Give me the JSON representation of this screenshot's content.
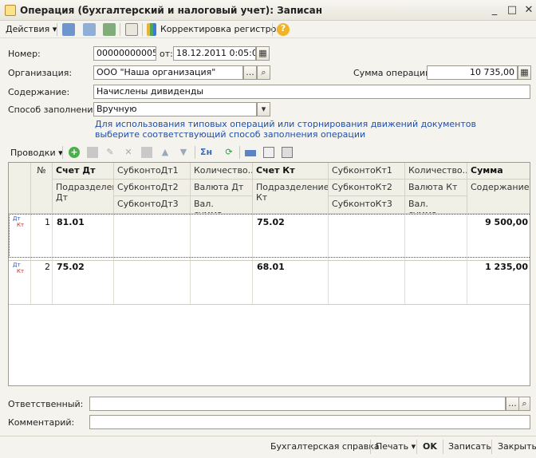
{
  "window": {
    "title": "Операция (бухгалтерский и налоговый учет): Записан"
  },
  "toolbar": {
    "actions": "Действия",
    "registers": "Корректировка регистров",
    "help_icon": "?"
  },
  "form": {
    "number_label": "Номер:",
    "number_value": "00000000005",
    "from_label": "от:",
    "date_value": "18.12.2011  0:05:05",
    "org_label": "Организация:",
    "org_value": "ООО \"Наша организация\"",
    "sum_label": "Сумма операции:",
    "sum_value": "10 735,00",
    "content_label": "Содержание:",
    "content_value": "Начислены дивиденды",
    "fill_label": "Способ заполнения:",
    "fill_value": "Вручную",
    "hint_line1": "Для использования типовых операций или сторнирования движений документов",
    "hint_line2": "выберите соответствующий способ заполнения операции"
  },
  "entries_toolbar": {
    "label": "Проводки"
  },
  "table": {
    "headers": {
      "num": "№",
      "r1": [
        "Счет Дт",
        "СубконтоДт1",
        "Количество...",
        "Счет Кт",
        "СубконтоКт1",
        "Количество...",
        "Сумма"
      ],
      "r2": [
        "Подразделение Дт",
        "СубконтоДт2",
        "Валюта Дт",
        "Подразделение Кт",
        "СубконтоКт2",
        "Валюта Кт",
        "Содержание"
      ],
      "r3": [
        "СубконтоДт3",
        "Вал. сумма...",
        "СубконтоКт3",
        "Вал. сумма..."
      ]
    },
    "row_icon": "ДтКт",
    "rows": [
      {
        "n": "1",
        "dt": "81.01",
        "kt": "75.02",
        "sum": "9 500,00"
      },
      {
        "n": "2",
        "dt": "75.02",
        "kt": "68.01",
        "sum": "1 235,00"
      }
    ]
  },
  "bottom": {
    "responsible_label": "Ответственный:",
    "comment_label": "Комментарий:"
  },
  "footer": {
    "report": "Бухгалтерская справка",
    "print": "Печать",
    "ok": "OK",
    "save": "Записать",
    "close": "Закрыть"
  }
}
